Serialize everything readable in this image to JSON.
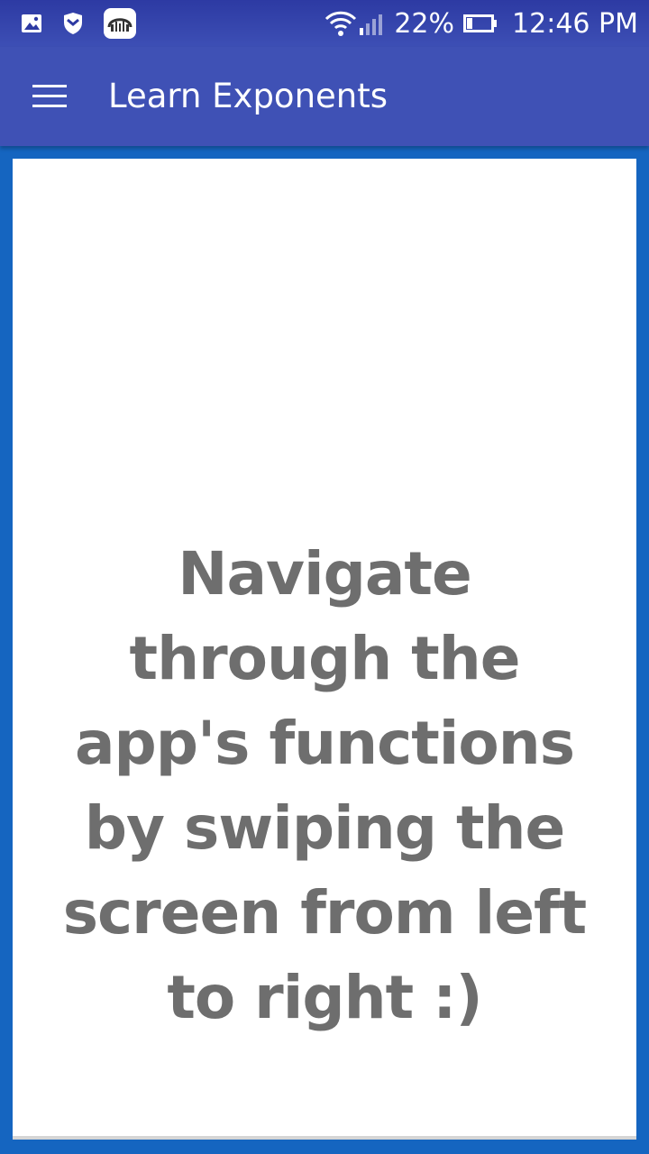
{
  "status_bar": {
    "left_icons": [
      "gallery-icon",
      "shield-icon",
      "audio-app-icon"
    ],
    "battery_percent": "22%",
    "time": "12:46 PM",
    "icons": [
      "wifi-icon",
      "signal-icon",
      "battery-icon"
    ]
  },
  "app_bar": {
    "title": "Learn Exponents",
    "menu_icon": "hamburger-menu-icon"
  },
  "card": {
    "lines": [
      "Navigate",
      "through the",
      "app's functions",
      "by swiping the",
      "screen from left",
      "to right :)"
    ]
  },
  "colors": {
    "status_bar": "#2d3aa3",
    "app_bar": "#3f51b5",
    "background": "#1565c0",
    "card": "#ffffff",
    "text": "#6e6e6e"
  }
}
